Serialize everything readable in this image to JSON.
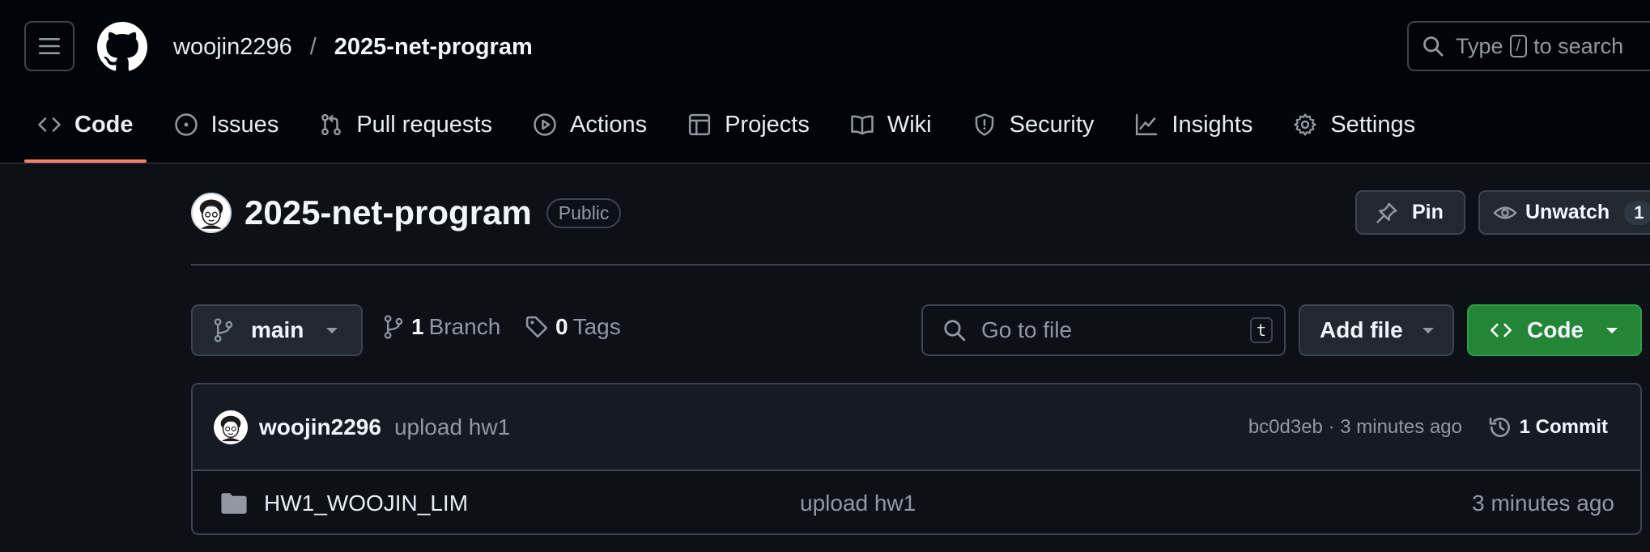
{
  "header": {
    "owner": "woojin2296",
    "separator": "/",
    "repo": "2025-net-program",
    "search": {
      "prefix": "Type",
      "key": "/",
      "suffix": "to search"
    }
  },
  "nav": {
    "tabs": [
      {
        "label": "Code",
        "icon": "code-icon",
        "active": true
      },
      {
        "label": "Issues",
        "icon": "issue-icon"
      },
      {
        "label": "Pull requests",
        "icon": "pull-request-icon"
      },
      {
        "label": "Actions",
        "icon": "play-icon"
      },
      {
        "label": "Projects",
        "icon": "table-icon"
      },
      {
        "label": "Wiki",
        "icon": "book-icon"
      },
      {
        "label": "Security",
        "icon": "shield-icon"
      },
      {
        "label": "Insights",
        "icon": "graph-icon"
      },
      {
        "label": "Settings",
        "icon": "gear-icon"
      }
    ]
  },
  "repo": {
    "name": "2025-net-program",
    "visibility": "Public",
    "pin_label": "Pin",
    "unwatch_label": "Unwatch",
    "watch_count": "1"
  },
  "toolbar": {
    "branch": "main",
    "branch_count": "1",
    "branch_label": "Branch",
    "tag_count": "0",
    "tag_label": "Tags",
    "goto_placeholder": "Go to file",
    "goto_key": "t",
    "add_file": "Add file",
    "code": "Code"
  },
  "commit": {
    "author": "woojin2296",
    "message": "upload hw1",
    "meta": "bc0d3eb · 3 minutes ago",
    "count": "1 Commit"
  },
  "files": [
    {
      "name": "HW1_WOOJIN_LIM",
      "message": "upload hw1",
      "age": "3 minutes ago"
    }
  ],
  "colors": {
    "bg": "#0d1117",
    "header_bg": "#010409",
    "accent_underline": "#f78166",
    "code_button": "#238636"
  }
}
